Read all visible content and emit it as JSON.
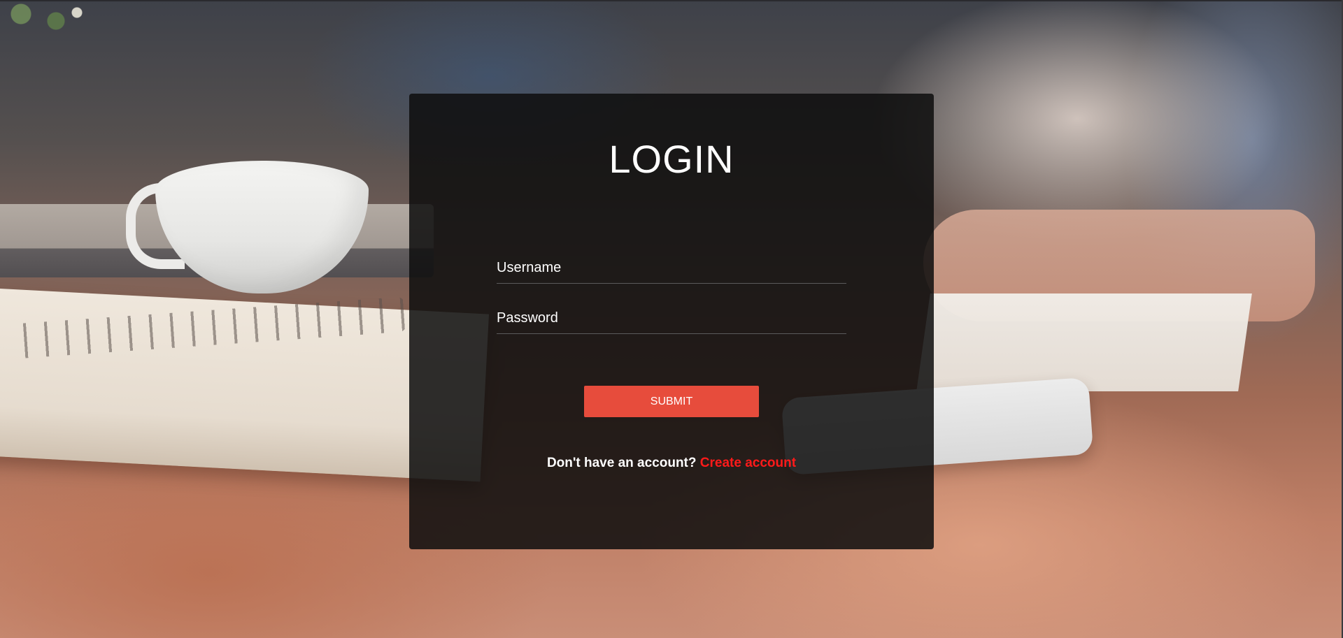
{
  "login": {
    "title": "LOGIN",
    "username_placeholder": "Username",
    "password_placeholder": "Password",
    "submit_label": "SUBMIT",
    "signup_prompt": "Don't have an account?",
    "signup_link": "Create account"
  },
  "colors": {
    "accent": "#e74c3c",
    "link": "#ff1a1a",
    "card_background": "rgba(14,14,14,0.86)"
  }
}
